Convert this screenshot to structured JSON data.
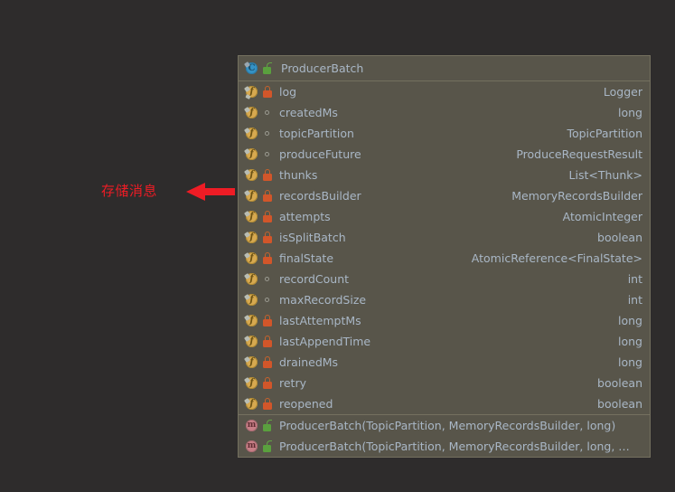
{
  "annotation": {
    "text": "存储消息",
    "color": "#ee1c25",
    "arrow_icon": "left-arrow-icon"
  },
  "colors": {
    "page_background": "#2e2c2c",
    "panel_background": "#58554a",
    "panel_border": "#74705f",
    "text": "#a9b7c6",
    "annotation_red": "#ee1c25",
    "class_icon": "#3592c4",
    "field_icon": "#d7a950",
    "method_icon": "#c87f87",
    "lock_private": "#d2562a",
    "lock_public": "#5aa03e"
  },
  "class_panel": {
    "header": {
      "name": "ProducerBatch",
      "kind_icon": "class-icon",
      "visibility_icon": "unlock-icon",
      "visibility": "public"
    },
    "fields": [
      {
        "name": "log",
        "type": "Logger",
        "visibility": "private",
        "kind_icon": "field-icon",
        "static": true
      },
      {
        "name": "createdMs",
        "type": "long",
        "visibility": "package",
        "kind_icon": "field-icon",
        "static": false
      },
      {
        "name": "topicPartition",
        "type": "TopicPartition",
        "visibility": "package",
        "kind_icon": "field-icon",
        "static": false
      },
      {
        "name": "produceFuture",
        "type": "ProduceRequestResult",
        "visibility": "package",
        "kind_icon": "field-icon",
        "static": false
      },
      {
        "name": "thunks",
        "type": "List<Thunk>",
        "visibility": "private",
        "kind_icon": "field-icon",
        "static": false
      },
      {
        "name": "recordsBuilder",
        "type": "MemoryRecordsBuilder",
        "visibility": "private",
        "kind_icon": "field-icon",
        "static": false
      },
      {
        "name": "attempts",
        "type": "AtomicInteger",
        "visibility": "private",
        "kind_icon": "field-icon",
        "static": false
      },
      {
        "name": "isSplitBatch",
        "type": "boolean",
        "visibility": "private",
        "kind_icon": "field-icon",
        "static": false
      },
      {
        "name": "finalState",
        "type": "AtomicReference<FinalState>",
        "visibility": "private",
        "kind_icon": "field-icon",
        "static": false
      },
      {
        "name": "recordCount",
        "type": "int",
        "visibility": "package",
        "kind_icon": "field-icon",
        "static": false
      },
      {
        "name": "maxRecordSize",
        "type": "int",
        "visibility": "package",
        "kind_icon": "field-icon",
        "static": false
      },
      {
        "name": "lastAttemptMs",
        "type": "long",
        "visibility": "private",
        "kind_icon": "field-icon",
        "static": false
      },
      {
        "name": "lastAppendTime",
        "type": "long",
        "visibility": "private",
        "kind_icon": "field-icon",
        "static": false
      },
      {
        "name": "drainedMs",
        "type": "long",
        "visibility": "private",
        "kind_icon": "field-icon",
        "static": false
      },
      {
        "name": "retry",
        "type": "boolean",
        "visibility": "private",
        "kind_icon": "field-icon",
        "static": false
      },
      {
        "name": "reopened",
        "type": "boolean",
        "visibility": "private",
        "kind_icon": "field-icon",
        "static": false
      }
    ],
    "methods": [
      {
        "name": "ProducerBatch(TopicPartition, MemoryRecordsBuilder, long)",
        "type": "",
        "visibility": "public",
        "kind_icon": "method-icon"
      },
      {
        "name": "ProducerBatch(TopicPartition, MemoryRecordsBuilder, long, boolean)",
        "type": "",
        "visibility": "public",
        "kind_icon": "method-icon"
      }
    ]
  }
}
